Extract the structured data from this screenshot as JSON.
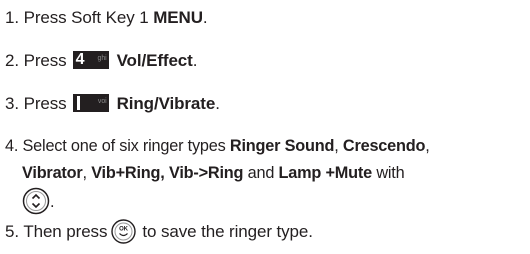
{
  "steps": [
    {
      "number": "1.",
      "text_before": "Press Soft Key 1",
      "bold": "MENU",
      "text_after": "."
    },
    {
      "number": "2.",
      "text_before": "Press",
      "key_digit": "4",
      "key_sub": "ghi",
      "bold": "Vol/Effect",
      "text_after": "."
    },
    {
      "number": "3.",
      "text_before": "Press",
      "key_digit": "1",
      "key_sub": "voi",
      "bold": "Ring/Vibrate",
      "text_after": "."
    },
    {
      "number": "4.",
      "text_before": "Select one of six ringer types",
      "type1": "Ringer Sound",
      "sep1": ",",
      "type2": "Crescendo",
      "sep2": ",",
      "type3": "Vibrator",
      "sep3": ",",
      "type4": "Vib+Ring, Vib->Ring",
      "sep4": "and",
      "type5": "Lamp +Mute",
      "with": "with",
      "end": "."
    },
    {
      "number": "5.",
      "text_before": "Then press",
      "ok_label": "OK",
      "text_after": "to save the ringer type."
    }
  ],
  "icons": {
    "key4": "keypad-4-icon",
    "key1": "keypad-1-icon",
    "nav": "navigation-key-icon",
    "ok": "ok-button-icon"
  }
}
